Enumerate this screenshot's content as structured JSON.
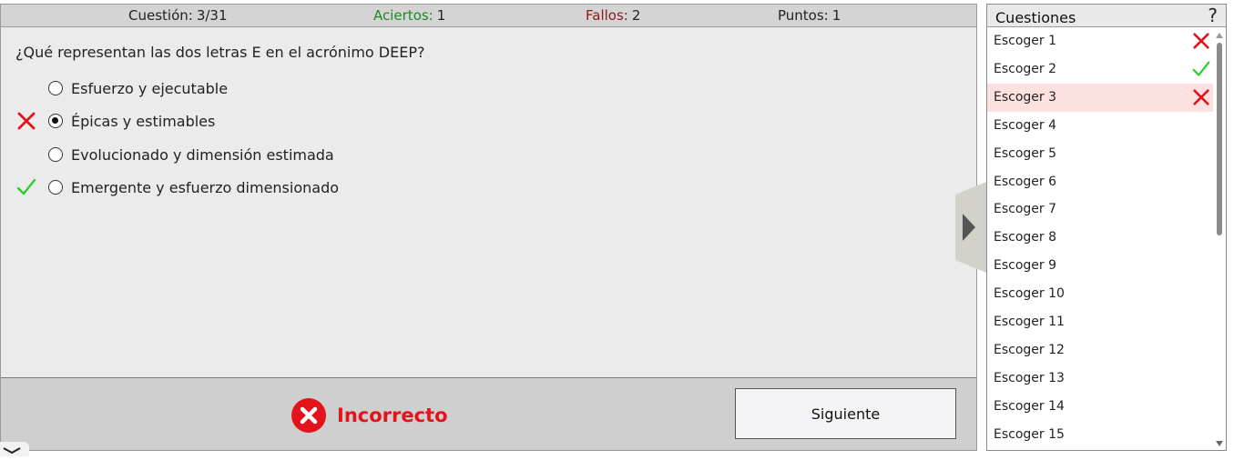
{
  "status": {
    "question_label": "Cuestión:",
    "question_value": "3/31",
    "correct_label": "Aciertos:",
    "correct_value": "1",
    "errors_label": "Fallos:",
    "errors_value": "2",
    "points_label": "Puntos:",
    "points_value": "1"
  },
  "question": {
    "text": "¿Qué representan las dos letras E en el acrónimo DEEP?",
    "options": [
      {
        "label": "Esfuerzo y ejecutable",
        "selected": false,
        "mark": null
      },
      {
        "label": "Épicas y estimables",
        "selected": true,
        "mark": "wrong"
      },
      {
        "label": "Evolucionado y dimensión estimada",
        "selected": false,
        "mark": null
      },
      {
        "label": "Emergente y esfuerzo dimensionado",
        "selected": false,
        "mark": "correct"
      }
    ]
  },
  "result": {
    "text": "Incorrecto",
    "icon": "x-circle-icon",
    "color": "#e3121b"
  },
  "next_button_label": "Siguiente",
  "sidebar": {
    "title": "Cuestiones",
    "help": "?",
    "items": [
      {
        "label": "Escoger 1",
        "status": "wrong"
      },
      {
        "label": "Escoger 2",
        "status": "correct"
      },
      {
        "label": "Escoger 3",
        "status": "wrong",
        "active": true
      },
      {
        "label": "Escoger 4",
        "status": null
      },
      {
        "label": "Escoger 5",
        "status": null
      },
      {
        "label": "Escoger 6",
        "status": null
      },
      {
        "label": "Escoger 7",
        "status": null
      },
      {
        "label": "Escoger 8",
        "status": null
      },
      {
        "label": "Escoger 9",
        "status": null
      },
      {
        "label": "Escoger 10",
        "status": null
      },
      {
        "label": "Escoger 11",
        "status": null
      },
      {
        "label": "Escoger 12",
        "status": null
      },
      {
        "label": "Escoger 13",
        "status": null
      },
      {
        "label": "Escoger 14",
        "status": null
      },
      {
        "label": "Escoger 15",
        "status": null
      }
    ]
  },
  "colors": {
    "correct": "#2ecc2e",
    "wrong": "#e3121b",
    "active_row": "#fde1e1"
  }
}
